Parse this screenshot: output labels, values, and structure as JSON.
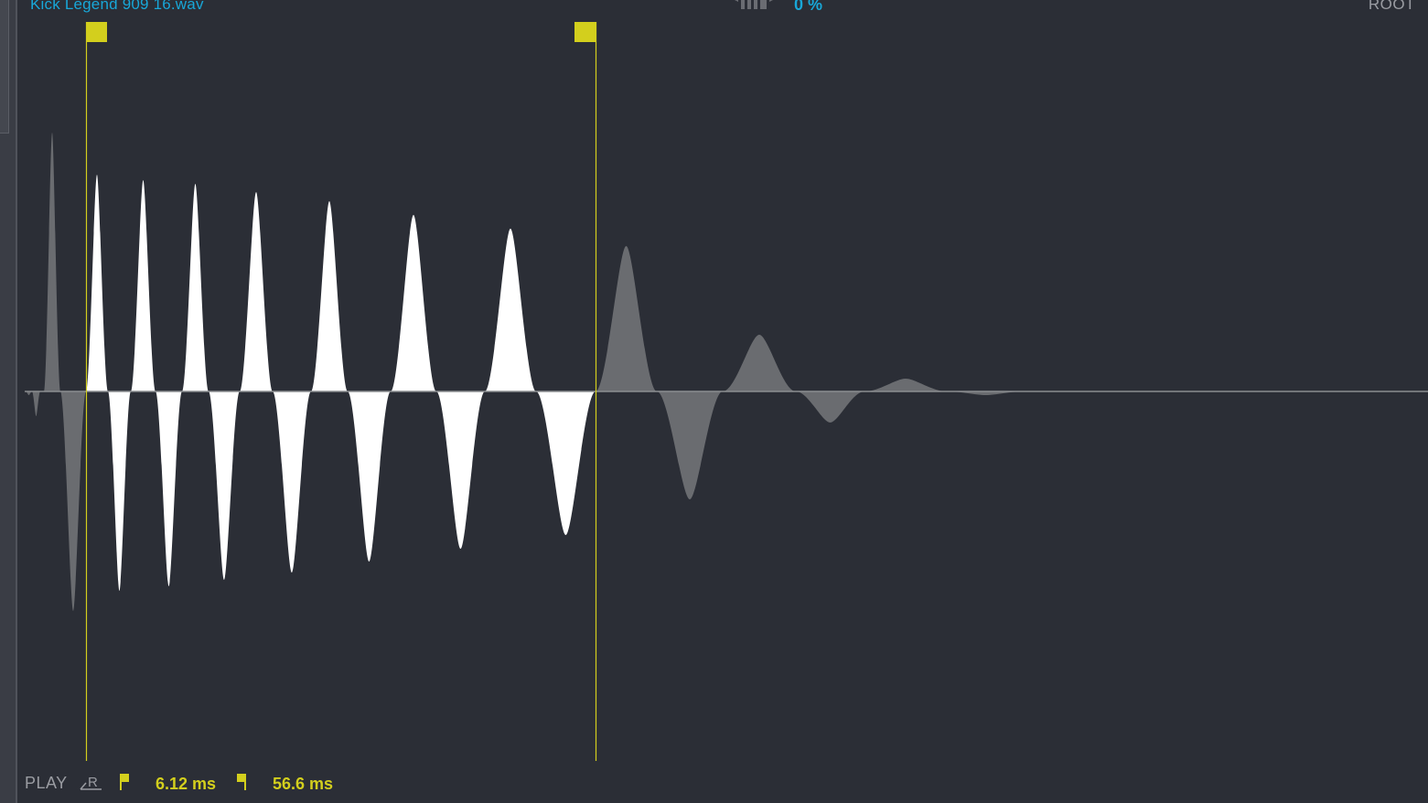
{
  "header": {
    "file_name": "Kick Legend 909 16.wav",
    "zoom_value": "0 %",
    "root_label": "ROOT"
  },
  "footer": {
    "play_label": "PLAY",
    "r_label": "R",
    "start_time": "6.12 ms",
    "end_time": "56.6 ms"
  },
  "colors": {
    "background": "#2b2e36",
    "waveform_active": "#ffffff",
    "waveform_inactive": "#6a6c70",
    "marker": "#d3cf1d",
    "accent": "#18a7d8",
    "muted_text": "#9a9ca2"
  },
  "icons": {
    "zoom": "piano-keys-icon",
    "reverse": "reverse-icon",
    "start_marker": "start-flag-icon",
    "end_marker": "end-flag-icon"
  }
}
